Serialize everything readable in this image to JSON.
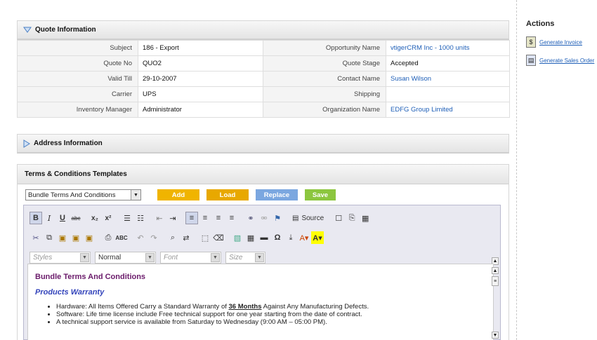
{
  "quote_section": {
    "title": "Quote Information",
    "rows": [
      {
        "l1": "Subject",
        "v1": "186 - Export",
        "l2": "Opportunity Name",
        "v2": "vtigerCRM Inc - 1000 units"
      },
      {
        "l1": "Quote No",
        "v1": "QUO2",
        "l2": "Quote Stage",
        "v2": "Accepted"
      },
      {
        "l1": "Valid Till",
        "v1": "29-10-2007",
        "l2": "Contact Name",
        "v2": "Susan Wilson"
      },
      {
        "l1": "Carrier",
        "v1": "UPS",
        "l2": "Shipping",
        "v2": ""
      },
      {
        "l1": "Inventory Manager",
        "v1": "Administrator",
        "l2": "Organization Name",
        "v2": "EDFG Group Limited"
      }
    ]
  },
  "address_section": {
    "title": "Address Information"
  },
  "terms_section": {
    "title": "Terms & Conditions Templates",
    "template_select": "Bundle Terms And Conditions",
    "buttons": {
      "add": "Add",
      "load": "Load",
      "replace": "Replace",
      "save": "Save"
    }
  },
  "editor": {
    "source_label": "Source",
    "styles_placeholder": "Styles",
    "format_value": "Normal",
    "font_placeholder": "Font",
    "size_placeholder": "Size",
    "heading": "Bundle Terms And Conditions",
    "subheading": "Products Warranty",
    "bullets": [
      {
        "pre": "Hardware: All Items Offered Carry a Standard Warranty of ",
        "bold": "36 Months",
        "post": " Against Any Manufacturing Defects."
      },
      {
        "pre": "Software: Life time license include Free technical support for one year starting from the date of contract.",
        "bold": "",
        "post": ""
      },
      {
        "pre": "A technical support service is available from Saturday to Wednesday (9:00 AM – 05:00 PM).",
        "bold": "",
        "post": ""
      }
    ]
  },
  "sidebar": {
    "title": "Actions",
    "actions": [
      {
        "label": "Generate Invoice",
        "icon": "invoice-icon"
      },
      {
        "label": "Generate Sales Order",
        "icon": "sales-order-icon"
      }
    ]
  },
  "colors": {
    "link": "#2060b8",
    "add": "#f0b400",
    "load": "#e8a800",
    "replace": "#7ba7e0",
    "save": "#8cc63f"
  }
}
